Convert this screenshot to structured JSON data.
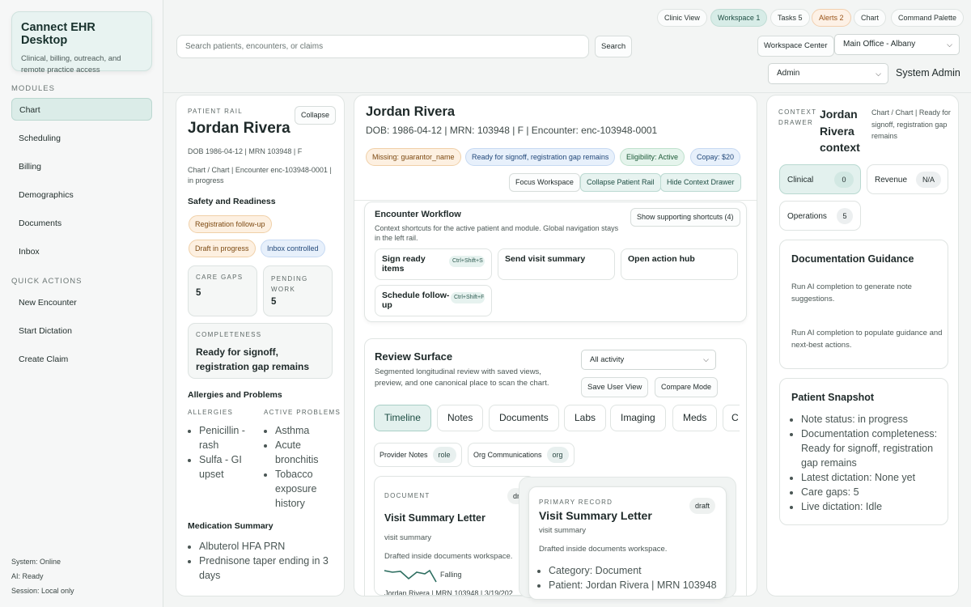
{
  "brand": {
    "title": "Cannect EHR Desktop",
    "subtitle": "Clinical, billing, outreach, and remote practice access"
  },
  "sidebar": {
    "modules_label": "MODULES",
    "modules": [
      "Chart",
      "Scheduling",
      "Billing",
      "Demographics",
      "Documents",
      "Inbox"
    ],
    "quick_label": "QUICK ACTIONS",
    "quick_actions": [
      "New Encounter",
      "Start Dictation",
      "Create Claim"
    ],
    "status": [
      "System: Online",
      "AI: Ready",
      "Session: Local only"
    ]
  },
  "topbar": {
    "pills": [
      "Clinic View",
      "Workspace 1",
      "Tasks 5",
      "Alerts 2",
      "Chart",
      "Command Palette"
    ],
    "search_placeholder": "Search patients, encounters, or claims",
    "search_button": "Search",
    "workspace_center": "Workspace Center",
    "location": "Main Office - Albany",
    "role": "Admin",
    "user": "System Admin"
  },
  "patient_rail": {
    "eyebrow": "PATIENT RAIL",
    "collapse": "Collapse",
    "name": "Jordan Rivera",
    "demo": "DOB 1986-04-12 | MRN 103948 | F",
    "context": "Chart / Chart | Encounter enc-103948-0001 | in progress",
    "safety_title": "Safety and Readiness",
    "tags": [
      "Registration follow-up",
      "Draft in progress",
      "Inbox controlled"
    ],
    "care_gaps_label": "CARE GAPS",
    "care_gaps_value": "5",
    "pending_label": "PENDING WORK",
    "pending_value": "5",
    "completeness_label": "COMPLETENESS",
    "completeness_value": "Ready for signoff, registration gap remains",
    "allergies_title": "Allergies and Problems",
    "allergies_label": "ALLERGIES",
    "allergies": [
      "Penicillin - rash",
      "Sulfa - GI upset"
    ],
    "problems_label": "ACTIVE PROBLEMS",
    "problems": [
      "Asthma",
      "Acute bronchitis",
      "Tobacco exposure history"
    ],
    "meds_title": "Medication Summary",
    "meds": [
      "Albuterol HFA PRN",
      "Prednisone taper ending in 3 days"
    ]
  },
  "header": {
    "name": "Jordan Rivera",
    "meta": "DOB: 1986-04-12 | MRN: 103948 | F | Encounter: enc-103948-0001",
    "tags": [
      "Missing: guarantor_name",
      "Ready for signoff, registration gap remains",
      "Eligibility: Active",
      "Copay: $20"
    ],
    "buttons": [
      "Focus Workspace",
      "Collapse Patient Rail",
      "Hide Context Drawer"
    ]
  },
  "workflow": {
    "title": "Encounter Workflow",
    "desc": "Context shortcuts for the active patient and module. Global navigation stays in the left rail.",
    "show_button": "Show supporting shortcuts (4)",
    "actions": [
      {
        "label": "Sign ready items",
        "shortcut": "Ctrl+Shift+S"
      },
      {
        "label": "Send visit summary",
        "shortcut": ""
      },
      {
        "label": "Open action hub",
        "shortcut": ""
      },
      {
        "label": "Schedule follow-up",
        "shortcut": "Ctrl+Shift+F"
      }
    ]
  },
  "review": {
    "title": "Review Surface",
    "desc": "Segmented longitudinal review with saved views, preview, and one canonical place to scan the chart.",
    "filter": "All activity",
    "save_view": "Save User View",
    "compare": "Compare Mode",
    "tabs": [
      "Timeline",
      "Notes",
      "Documents",
      "Labs",
      "Imaging",
      "Meds",
      "C"
    ],
    "chips": [
      {
        "label": "Provider Notes",
        "tag": "role"
      },
      {
        "label": "Org Communications",
        "tag": "org"
      }
    ],
    "doc_card": {
      "eyebrow": "DOCUMENT",
      "badge": "dr",
      "title": "Visit Summary Letter",
      "type": "visit summary",
      "desc": "Drafted inside documents workspace.",
      "trend": "Falling",
      "footer": "Jordan Rivera | MRN 103948 | 3/19/202"
    },
    "primary": {
      "eyebrow": "PRIMARY RECORD",
      "badge": "draft",
      "title": "Visit Summary Letter",
      "type": "visit summary",
      "desc": "Drafted inside documents workspace.",
      "items": [
        "Category: Document",
        "Patient: Jordan Rivera | MRN 103948"
      ]
    }
  },
  "drawer": {
    "eyebrow": "CONTEXT DRAWER",
    "title": "Jordan Rivera context",
    "status": "Chart / Chart | Ready for signoff, registration gap remains",
    "stats": [
      {
        "label": "Clinical",
        "value": "0"
      },
      {
        "label": "Revenue",
        "value": "N/A"
      },
      {
        "label": "Operations",
        "value": "5"
      }
    ],
    "guidance_title": "Documentation Guidance",
    "guidance": [
      "Run AI completion to generate note suggestions.",
      "Run AI completion to populate guidance and next-best actions."
    ],
    "snapshot_title": "Patient Snapshot",
    "snapshot": [
      "Note status: in progress",
      "Documentation completeness: Ready for signoff, registration gap remains",
      "Latest dictation: None yet",
      "Care gaps: 5",
      "Live dictation: Idle"
    ]
  }
}
